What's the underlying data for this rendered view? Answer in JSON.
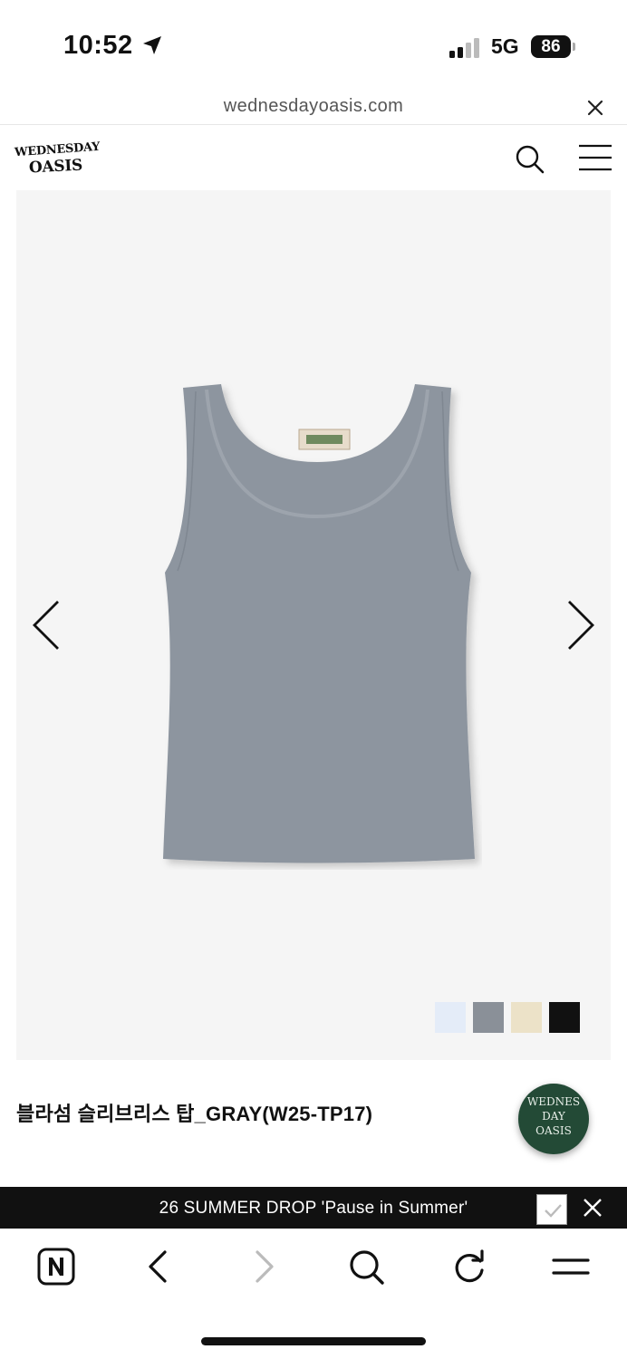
{
  "status_bar": {
    "time": "10:52",
    "network": "5G",
    "battery": "86"
  },
  "browser": {
    "url": "wednesdayoasis.com"
  },
  "site": {
    "logo_line1": "WEDNESDAY",
    "logo_line2": "OASIS"
  },
  "product": {
    "title": "블라섬 슬리브리스 탑_GRAY(W25-TP17)",
    "color_swatches": [
      {
        "color": "#e4ecf8"
      },
      {
        "color": "#8a9098"
      },
      {
        "color": "#ece2c8"
      },
      {
        "color": "#111111"
      }
    ],
    "image_color": "#8d959f"
  },
  "chat_badge": {
    "line1": "WEDNES",
    "line2": "DAY",
    "line3": "OASIS"
  },
  "notice": {
    "text": "26 SUMMER DROP 'Pause in Summer'"
  },
  "colors": {
    "accent_green": "#234a36",
    "notice_bg": "#111111",
    "gallery_bg": "#f5f5f5"
  }
}
